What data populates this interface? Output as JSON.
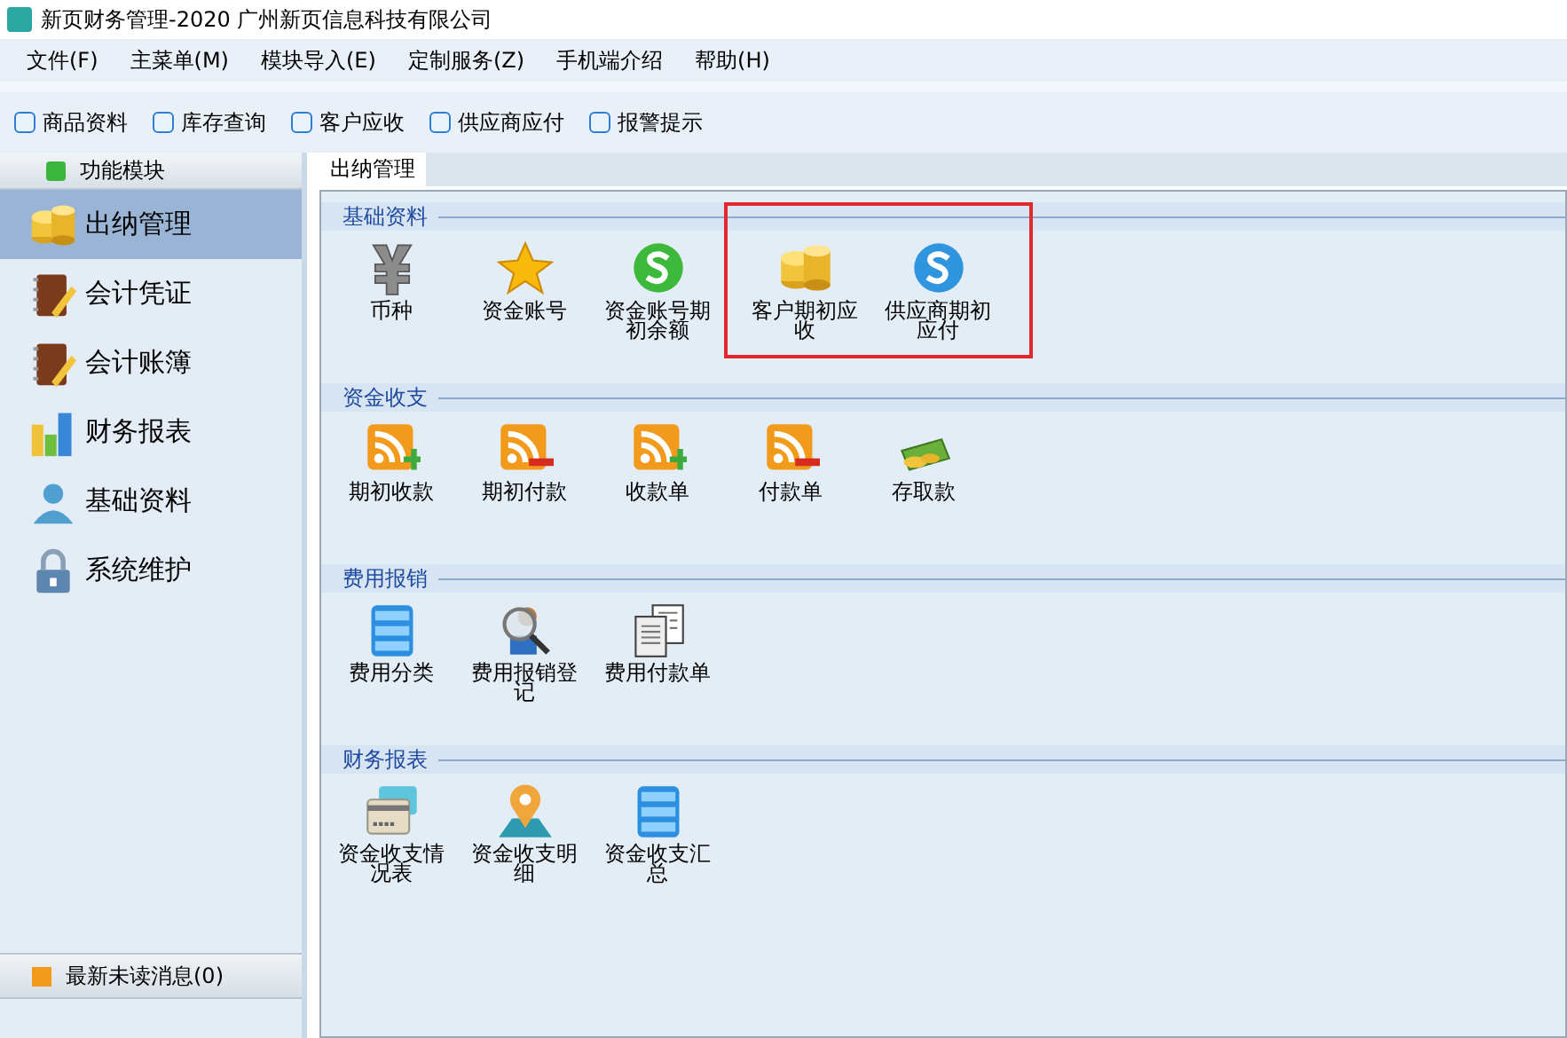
{
  "window": {
    "title": "新页财务管理-2020 广州新页信息科技有限公司"
  },
  "menu": [
    "文件(F)",
    "主菜单(M)",
    "模块导入(E)",
    "定制服务(Z)",
    "手机端介绍",
    "帮助(H)"
  ],
  "toolbar": [
    "商品资料",
    "库存查询",
    "客户应收",
    "供应商应付",
    "报警提示"
  ],
  "sidebar": {
    "title": "功能模块",
    "items": [
      {
        "label": "出纳管理",
        "kind": "coins",
        "selected": true
      },
      {
        "label": "会计凭证",
        "kind": "notebook",
        "selected": false
      },
      {
        "label": "会计账簿",
        "kind": "notebook",
        "selected": false
      },
      {
        "label": "财务报表",
        "kind": "bars",
        "selected": false
      },
      {
        "label": "基础资料",
        "kind": "person",
        "selected": false
      },
      {
        "label": "系统维护",
        "kind": "lock",
        "selected": false
      }
    ],
    "footer": "最新未读消息(0)"
  },
  "tabs": [
    {
      "label": "出纳管理",
      "selected": true
    }
  ],
  "groups": [
    {
      "title": "基础资料",
      "items": [
        {
          "label": "币种",
          "kind": "yen",
          "highlighted": false
        },
        {
          "label": "资金账号",
          "kind": "star",
          "highlighted": false
        },
        {
          "label": "资金账号期初余额",
          "kind": "green-s",
          "highlighted": false
        },
        {
          "label": "客户期初应收",
          "kind": "coins",
          "highlighted": true
        },
        {
          "label": "供应商期初应付",
          "kind": "blue-s",
          "highlighted": true
        }
      ]
    },
    {
      "title": "资金收支",
      "items": [
        {
          "label": "期初收款",
          "kind": "feed-plus",
          "highlighted": false
        },
        {
          "label": "期初付款",
          "kind": "feed-minus",
          "highlighted": false
        },
        {
          "label": "收款单",
          "kind": "feed-plus",
          "highlighted": false
        },
        {
          "label": "付款单",
          "kind": "feed-minus",
          "highlighted": false
        },
        {
          "label": "存取款",
          "kind": "cash",
          "highlighted": false
        }
      ]
    },
    {
      "title": "费用报销",
      "items": [
        {
          "label": "费用分类",
          "kind": "database",
          "highlighted": false
        },
        {
          "label": "费用报销登记",
          "kind": "magnifier",
          "highlighted": false
        },
        {
          "label": "费用付款单",
          "kind": "documents",
          "highlighted": false
        }
      ]
    },
    {
      "title": "财务报表",
      "items": [
        {
          "label": "资金收支情况表",
          "kind": "card",
          "highlighted": false
        },
        {
          "label": "资金收支明细",
          "kind": "pin",
          "highlighted": false
        },
        {
          "label": "资金收支汇总",
          "kind": "database",
          "highlighted": false
        }
      ]
    }
  ]
}
